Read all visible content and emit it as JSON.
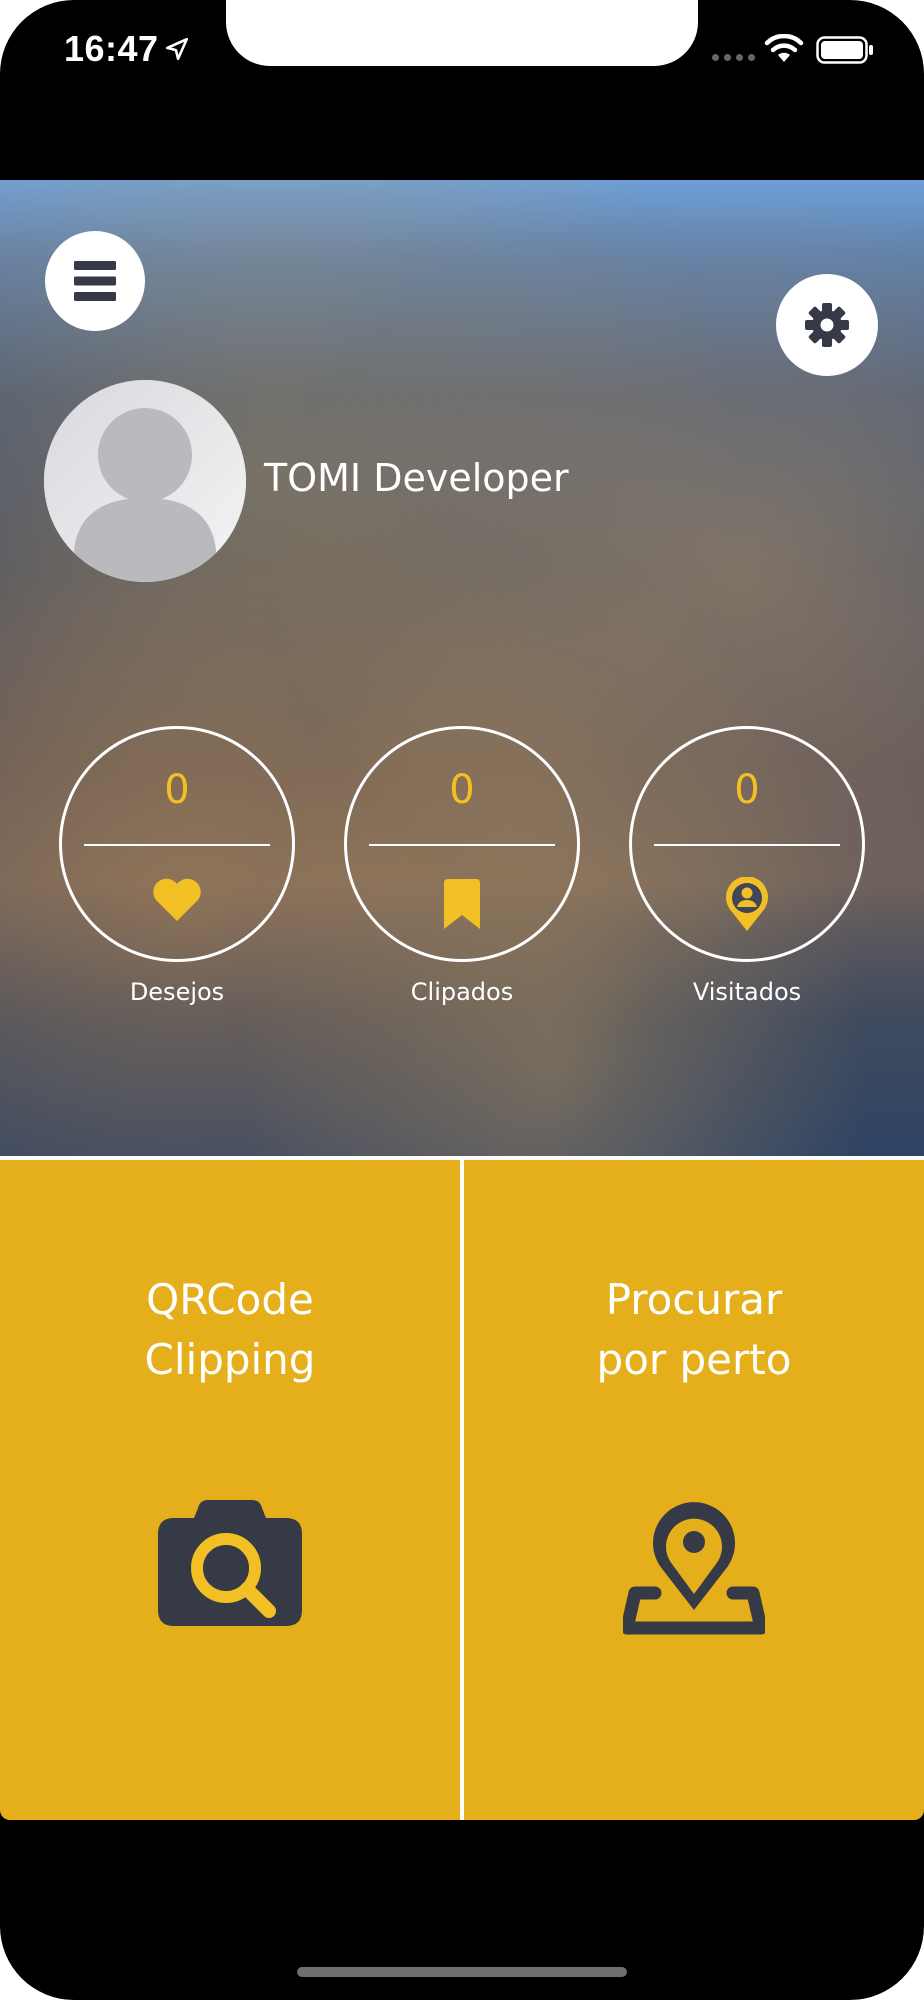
{
  "status_bar": {
    "time": "16:47"
  },
  "profile": {
    "name": "TOMI Developer"
  },
  "stats": [
    {
      "count": "0",
      "label": "Desejos",
      "icon": "heart-icon"
    },
    {
      "count": "0",
      "label": "Clipados",
      "icon": "bookmark-icon"
    },
    {
      "count": "0",
      "label": "Visitados",
      "icon": "map-pin-person-icon"
    }
  ],
  "tiles": [
    {
      "line1": "QRCode",
      "line2": "Clipping",
      "icon": "camera-search-icon"
    },
    {
      "line1": "Procurar",
      "line2": "por perto",
      "icon": "location-pin-area-icon"
    }
  ],
  "colors": {
    "accent": "#e5ae1b",
    "count_yellow": "#f2bf24",
    "icon_dark": "#353a46"
  }
}
